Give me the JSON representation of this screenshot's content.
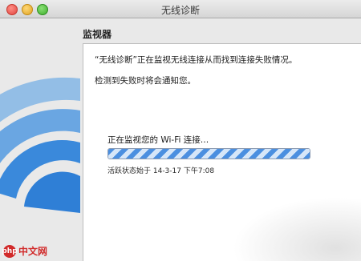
{
  "window": {
    "title": "无线诊断"
  },
  "section": {
    "title": "监视器"
  },
  "panel": {
    "message_line1": "“无线诊断”正在监视无线连接从而找到连接失败情况。",
    "message_line2": "检测到失败时将会通知您。",
    "status_text": "正在监视您的 Wi-Fi 连接…",
    "progress_fraction": 1.0,
    "timestamp": "活跃状态始于 14-3-17 下午7:08"
  },
  "watermark": {
    "logo_text": "php",
    "text": "中文网"
  },
  "colors": {
    "wifi_blue": "#3e8edb",
    "progress_blue": "#4b8fe0"
  },
  "icons": [
    "wifi-icon",
    "close-icon",
    "minimize-icon",
    "maximize-icon"
  ]
}
